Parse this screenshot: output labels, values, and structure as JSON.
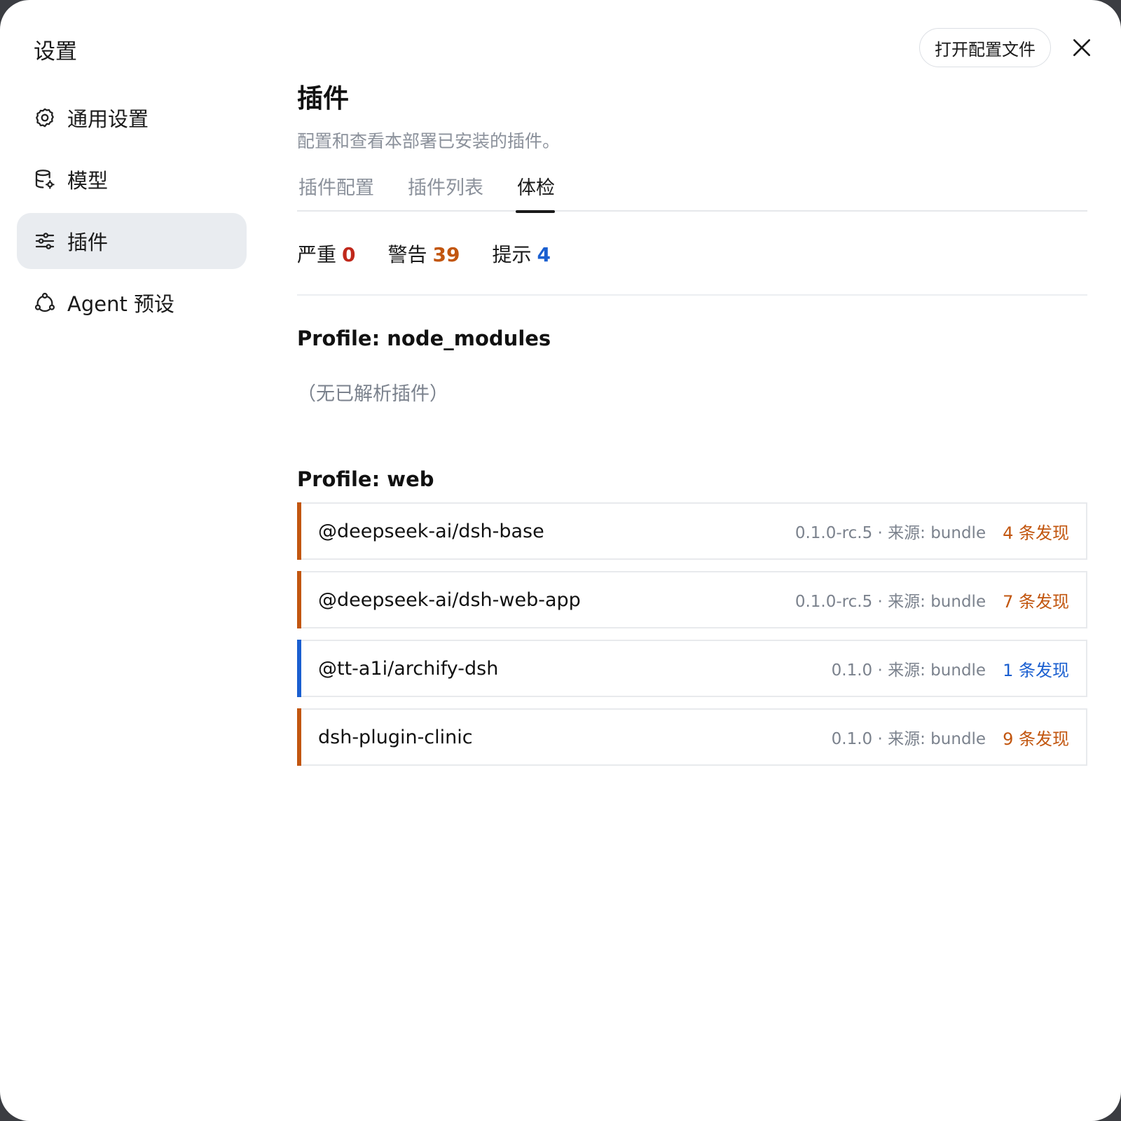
{
  "app": {
    "title": "设置"
  },
  "sidebar": {
    "items": [
      {
        "label": "通用设置",
        "icon": "gear-icon"
      },
      {
        "label": "模型",
        "icon": "database-icon"
      },
      {
        "label": "插件",
        "icon": "sliders-icon",
        "active": true
      },
      {
        "label": "Agent 预设",
        "icon": "agent-preset-icon"
      }
    ]
  },
  "header": {
    "open_config_label": "打开配置文件",
    "close_icon": "close-icon"
  },
  "main": {
    "title": "插件",
    "description": "配置和查看本部署已安装的插件。",
    "tabs": [
      {
        "label": "插件配置"
      },
      {
        "label": "插件列表"
      },
      {
        "label": "体检",
        "active": true
      }
    ],
    "summary": [
      {
        "label": "严重",
        "count": "0",
        "color": "#c0281b"
      },
      {
        "label": "警告",
        "count": "39",
        "color": "#c2560f"
      },
      {
        "label": "提示",
        "count": "4",
        "color": "#1a5fd0"
      }
    ],
    "profiles": [
      {
        "title": "Profile: node_modules",
        "empty_text": "（无已解析插件）"
      },
      {
        "title": "Profile: web",
        "plugins": [
          {
            "name": "@deepseek-ai/dsh-base",
            "meta": "0.1.0-rc.5 · 来源: bundle",
            "findings": "4 条发现",
            "severity_color": "#c2560f"
          },
          {
            "name": "@deepseek-ai/dsh-web-app",
            "meta": "0.1.0-rc.5 · 来源: bundle",
            "findings": "7 条发现",
            "severity_color": "#c2560f"
          },
          {
            "name": "@tt-a1i/archify-dsh",
            "meta": "0.1.0 · 来源: bundle",
            "findings": "1 条发现",
            "severity_color": "#1a5fd0"
          },
          {
            "name": "dsh-plugin-clinic",
            "meta": "0.1.0 · 来源: bundle",
            "findings": "9 条发现",
            "severity_color": "#c2560f"
          }
        ]
      }
    ]
  }
}
